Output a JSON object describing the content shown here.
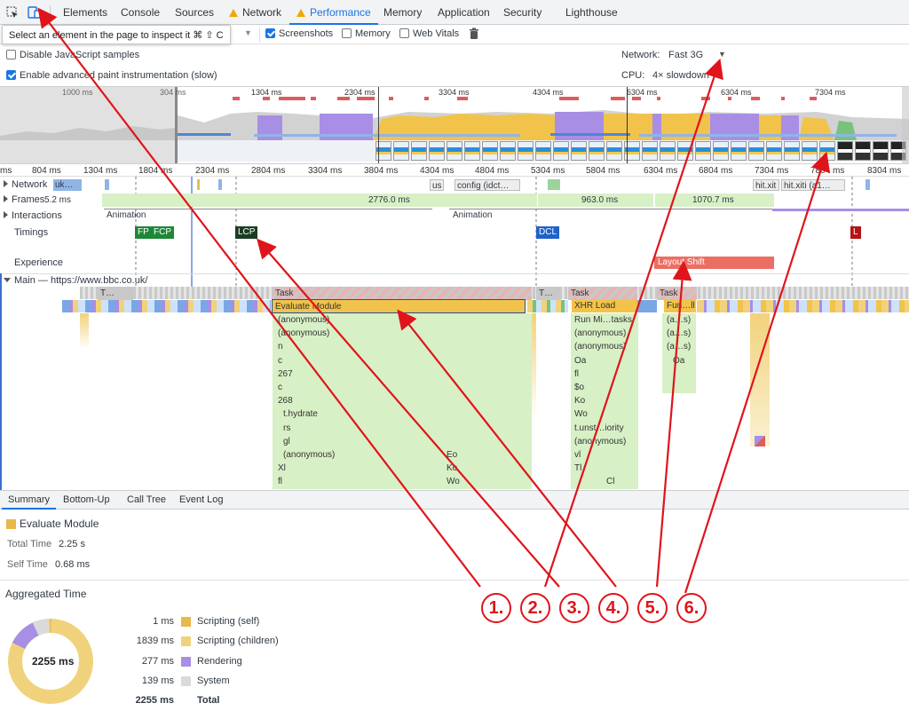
{
  "tabs": [
    "Elements",
    "Console",
    "Sources",
    "Network",
    "Performance",
    "Memory",
    "Application",
    "Security",
    "Lighthouse"
  ],
  "tooltip": "Select an element in the page to inspect it  ⌘ ⇧ C",
  "toolbar": {
    "screenshots": "Screenshots",
    "memory": "Memory",
    "web_vitals": "Web Vitals"
  },
  "settings": {
    "disable_js": "Disable JavaScript samples",
    "advanced_paint": "Enable advanced paint instrumentation (slow)",
    "network_label": "Network:",
    "network_value": "Fast 3G",
    "cpu_label": "CPU:",
    "cpu_value": "4× slowdown"
  },
  "overview_ticks": [
    "1000 ms",
    "304 ms",
    "1304 ms",
    "2304 ms",
    "3304 ms",
    "4304 ms",
    "6304 ms",
    "6304 ms",
    "7304 ms"
  ],
  "ruler_ticks": [
    "ms",
    "804 ms",
    "1304 ms",
    "1804 ms",
    "2304 ms",
    "2804 ms",
    "3304 ms",
    "3804 ms",
    "4304 ms",
    "4804 ms",
    "5304 ms",
    "5804 ms",
    "6304 ms",
    "6804 ms",
    "7304 ms",
    "7804 ms",
    "8304 ms"
  ],
  "tracks": {
    "network": "Network",
    "network_frag": "uk…",
    "network_items": [
      "us",
      "config (idct…",
      "hit.xit",
      "hit.xiti (a1…"
    ],
    "frames": "Frames",
    "frames_values": [
      "5.2 ms",
      "2776.0 ms",
      "963.0 ms",
      "1070.7 ms"
    ],
    "interactions": "Interactions",
    "animation": "Animation",
    "timings": "Timings",
    "timing_marks": [
      "FP",
      "FCP",
      "LCP",
      "DCL",
      "L"
    ],
    "experience": "Experience",
    "layout_shift": "Layout Shift",
    "main": "Main — https://www.bbc.co.uk/"
  },
  "flame": {
    "task": "Task",
    "task_short": "T…",
    "col1": [
      "Evaluate Module",
      "(anonymous)",
      "(anonymous)",
      "n",
      "c",
      "267",
      "c",
      "268",
      "t.hydrate",
      "rs",
      "gl",
      "(anonymous)",
      "Xl",
      "fl"
    ],
    "col1b": [
      "Eo",
      "Ko",
      "Wo"
    ],
    "col2": [
      "XHR Load",
      "Run Mi…tasks",
      "(anonymous)",
      "(anonymous)",
      "Oa",
      "fl",
      "$o",
      "Ko",
      "Wo",
      "t.unst…iority",
      "(anonymous)",
      "vl",
      "Tl",
      "Cl"
    ],
    "col3": [
      "Fun…ll",
      "(a…s)",
      "(a…s)",
      "(a…s)",
      "Oa"
    ]
  },
  "bottom_tabs": [
    "Summary",
    "Bottom-Up",
    "Call Tree",
    "Event Log"
  ],
  "summary": {
    "title": "Evaluate Module",
    "total_time_label": "Total Time",
    "total_time_value": "2.25 s",
    "self_time_label": "Self Time",
    "self_time_value": "0.68 ms",
    "aggregated": "Aggregated Time",
    "donut_center": "2255 ms",
    "rows": [
      {
        "ms": "1 ms",
        "label": "Scripting (self)",
        "color": "#e8b84b"
      },
      {
        "ms": "1839 ms",
        "label": "Scripting (children)",
        "color": "#f1d27c"
      },
      {
        "ms": "277 ms",
        "label": "Rendering",
        "color": "#a88ee5"
      },
      {
        "ms": "139 ms",
        "label": "System",
        "color": "#dadada"
      }
    ],
    "total_ms": "2255 ms",
    "total_label": "Total"
  },
  "annotations": [
    "1.",
    "2.",
    "3.",
    "4.",
    "5.",
    "6."
  ],
  "colors": {
    "accent": "#1a73e8",
    "annotation": "#e0141b",
    "scripting": "#f1d27c",
    "rendering": "#a88ee5",
    "frames": "#d7f0c6"
  }
}
